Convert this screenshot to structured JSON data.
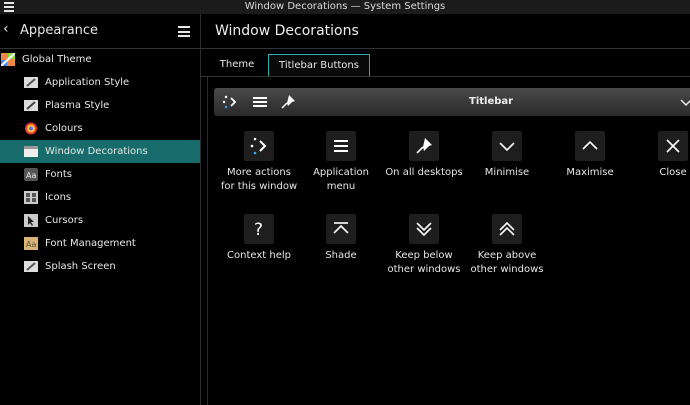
{
  "window": {
    "title": "Window Decorations — System Settings"
  },
  "sidebar": {
    "header": "Appearance",
    "items": [
      {
        "label": "Global Theme"
      },
      {
        "label": "Application Style"
      },
      {
        "label": "Plasma Style"
      },
      {
        "label": "Colours"
      },
      {
        "label": "Window Decorations"
      },
      {
        "label": "Fonts"
      },
      {
        "label": "Icons"
      },
      {
        "label": "Cursors"
      },
      {
        "label": "Font Management"
      },
      {
        "label": "Splash Screen"
      }
    ]
  },
  "main": {
    "title": "Window Decorations",
    "tabs": [
      {
        "label": "Theme"
      },
      {
        "label": "Titlebar Buttons"
      }
    ],
    "preview": {
      "label": "Titlebar"
    },
    "buttons": [
      {
        "label": "More actions\nfor this window",
        "icon": "more-actions-icon"
      },
      {
        "label": "Application\nmenu",
        "icon": "application-menu-icon"
      },
      {
        "label": "On all desktops",
        "icon": "pin-icon"
      },
      {
        "label": "Minimise",
        "icon": "minimise-icon"
      },
      {
        "label": "Maximise",
        "icon": "maximise-icon"
      },
      {
        "label": "Close",
        "icon": "close-icon"
      },
      {
        "label": "Context help",
        "icon": "help-icon"
      },
      {
        "label": "Shade",
        "icon": "shade-icon"
      },
      {
        "label": "Keep below\nother windows",
        "icon": "keep-below-icon"
      },
      {
        "label": "Keep above\nother windows",
        "icon": "keep-above-icon"
      }
    ]
  },
  "colors": {
    "selection": "#176b6b",
    "accent": "#33aaaa",
    "background": "#000000"
  }
}
